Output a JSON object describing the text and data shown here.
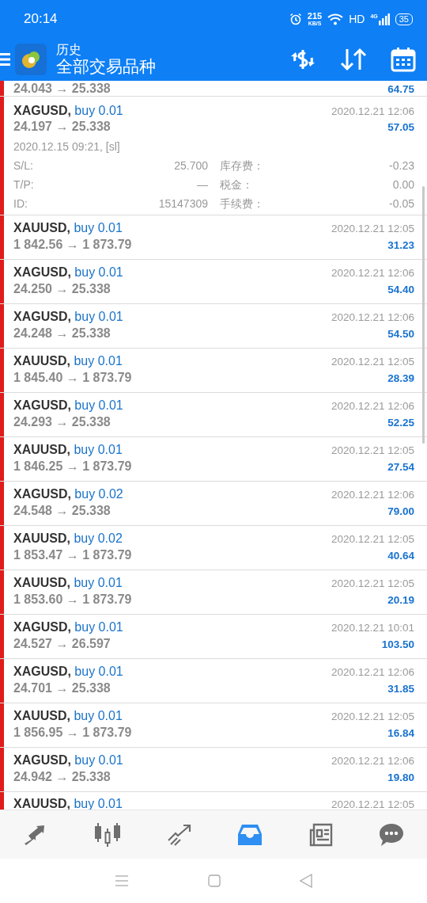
{
  "status_bar": {
    "time": "20:14",
    "speed": "215",
    "speed_unit": "KB/S",
    "hd": "HD",
    "network": "4G",
    "battery": "35"
  },
  "header": {
    "title": "历史",
    "subtitle": "全部交易品种"
  },
  "top_partial_row": {
    "prices": "24.043 → 25.338",
    "profit": "64.75"
  },
  "rows": [
    {
      "symbol": "XAGUSD,",
      "order": "buy 0.01",
      "prices": "24.197 → 25.338",
      "time": "2020.12.21 12:06",
      "profit": "57.05",
      "expanded": true,
      "open_info": "2020.12.15 09:21, [sl]",
      "fields": [
        {
          "label": "S/L:",
          "value": "25.700"
        },
        {
          "label": "库存费：",
          "value": "-0.23"
        },
        {
          "label": "T/P:",
          "value": "—"
        },
        {
          "label": "税金：",
          "value": "0.00"
        },
        {
          "label": "ID:",
          "value": "15147309"
        },
        {
          "label": "手续费：",
          "value": "-0.05"
        }
      ]
    },
    {
      "symbol": "XAUUSD,",
      "order": "buy 0.01",
      "prices": "1 842.56 → 1 873.79",
      "time": "2020.12.21 12:05",
      "profit": "31.23",
      "expanded": false
    },
    {
      "symbol": "XAGUSD,",
      "order": "buy 0.01",
      "prices": "24.250 → 25.338",
      "time": "2020.12.21 12:06",
      "profit": "54.40",
      "expanded": false
    },
    {
      "symbol": "XAGUSD,",
      "order": "buy 0.01",
      "prices": "24.248 → 25.338",
      "time": "2020.12.21 12:06",
      "profit": "54.50",
      "expanded": false
    },
    {
      "symbol": "XAUUSD,",
      "order": "buy 0.01",
      "prices": "1 845.40 → 1 873.79",
      "time": "2020.12.21 12:05",
      "profit": "28.39",
      "expanded": false
    },
    {
      "symbol": "XAGUSD,",
      "order": "buy 0.01",
      "prices": "24.293 → 25.338",
      "time": "2020.12.21 12:06",
      "profit": "52.25",
      "expanded": false
    },
    {
      "symbol": "XAUUSD,",
      "order": "buy 0.01",
      "prices": "1 846.25 → 1 873.79",
      "time": "2020.12.21 12:05",
      "profit": "27.54",
      "expanded": false
    },
    {
      "symbol": "XAGUSD,",
      "order": "buy 0.02",
      "prices": "24.548 → 25.338",
      "time": "2020.12.21 12:06",
      "profit": "79.00",
      "expanded": false
    },
    {
      "symbol": "XAUUSD,",
      "order": "buy 0.02",
      "prices": "1 853.47 → 1 873.79",
      "time": "2020.12.21 12:05",
      "profit": "40.64",
      "expanded": false
    },
    {
      "symbol": "XAUUSD,",
      "order": "buy 0.01",
      "prices": "1 853.60 → 1 873.79",
      "time": "2020.12.21 12:05",
      "profit": "20.19",
      "expanded": false
    },
    {
      "symbol": "XAGUSD,",
      "order": "buy 0.01",
      "prices": "24.527 → 26.597",
      "time": "2020.12.21 10:01",
      "profit": "103.50",
      "expanded": false
    },
    {
      "symbol": "XAGUSD,",
      "order": "buy 0.01",
      "prices": "24.701 → 25.338",
      "time": "2020.12.21 12:06",
      "profit": "31.85",
      "expanded": false
    },
    {
      "symbol": "XAUUSD,",
      "order": "buy 0.01",
      "prices": "1 856.95 → 1 873.79",
      "time": "2020.12.21 12:05",
      "profit": "16.84",
      "expanded": false
    },
    {
      "symbol": "XAGUSD,",
      "order": "buy 0.01",
      "prices": "24.942 → 25.338",
      "time": "2020.12.21 12:06",
      "profit": "19.80",
      "expanded": false
    }
  ],
  "bottom_partial_row": {
    "symbol": "XAUUSD,",
    "order": "buy 0.01",
    "time": "2020.12.21 12:05"
  },
  "bottom_nav": [
    {
      "kind": "quotes",
      "selected": false
    },
    {
      "kind": "chart",
      "selected": false
    },
    {
      "kind": "trade",
      "selected": false
    },
    {
      "kind": "history",
      "selected": true
    },
    {
      "kind": "news",
      "selected": false
    },
    {
      "kind": "chat",
      "selected": false
    }
  ]
}
